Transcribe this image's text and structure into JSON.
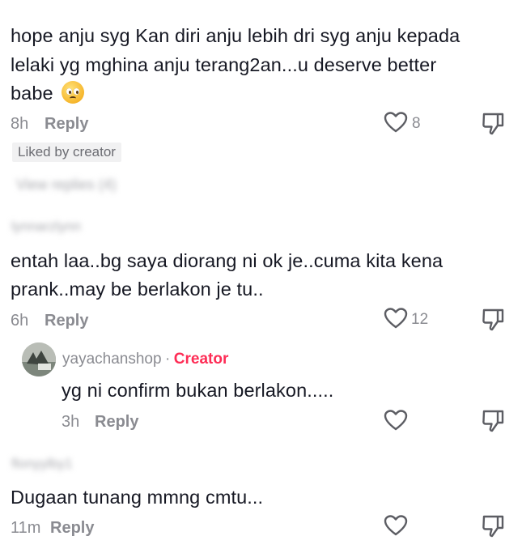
{
  "comments": [
    {
      "text_lines": [
        "hope anju syg Kan diri anju lebih dri syg anju kepada",
        "lelaki yg mghina anju terang2an...u deserve better",
        "babe"
      ],
      "emoji": "pleading-face",
      "time": "8h",
      "reply_label": "Reply",
      "likes": "8",
      "liked_by_creator": "Liked by creator",
      "view_replies": "View replies (4)",
      "username_next": "lynnarzlynn"
    },
    {
      "text_lines": [
        "entah laa..bg saya diorang ni ok je..cuma kita kena",
        "prank..may be berlakon je tu.."
      ],
      "time": "6h",
      "reply_label": "Reply",
      "likes": "12"
    },
    {
      "username": "yayachanshop",
      "separator": "·",
      "creator_label": "Creator",
      "text": "yg ni confirm bukan berlakon.....",
      "time": "3h",
      "reply_label": "Reply"
    },
    {
      "username_blurred": "flonyylby1",
      "text": "Dugaan tunang mmng cmtu...",
      "time": "11m",
      "reply_label": "Reply"
    }
  ],
  "icons": {
    "like": "heart-outline-icon",
    "dislike": "thumbs-down-outline-icon"
  }
}
